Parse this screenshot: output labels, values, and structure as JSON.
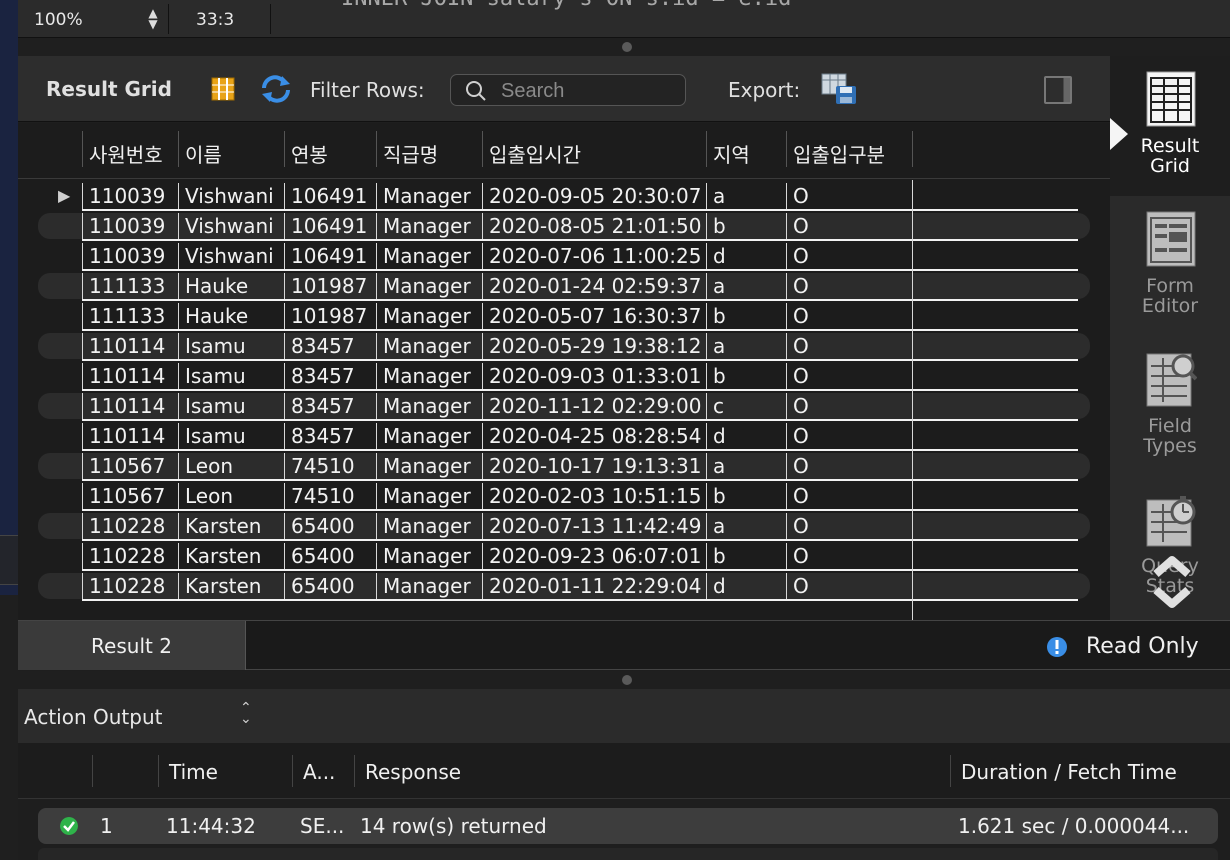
{
  "editor": {
    "code_peek": "    INNER JOIN salary s ON s.id = e.id",
    "zoom": "100%",
    "cursor_position": "33:3"
  },
  "result_toolbar": {
    "title": "Result Grid",
    "filter_label": "Filter Rows:",
    "search_placeholder": "Search",
    "export_label": "Export:"
  },
  "grid": {
    "columns": [
      "사원번호",
      "이름",
      "연봉",
      "직급명",
      "입출입시간",
      "지역",
      "입출입구분"
    ],
    "rows": [
      [
        "110039",
        "Vishwani",
        "106491",
        "Manager",
        "2020-09-05 20:30:07",
        "a",
        "O"
      ],
      [
        "110039",
        "Vishwani",
        "106491",
        "Manager",
        "2020-08-05 21:01:50",
        "b",
        "O"
      ],
      [
        "110039",
        "Vishwani",
        "106491",
        "Manager",
        "2020-07-06 11:00:25",
        "d",
        "O"
      ],
      [
        "111133",
        "Hauke",
        "101987",
        "Manager",
        "2020-01-24 02:59:37",
        "a",
        "O"
      ],
      [
        "111133",
        "Hauke",
        "101987",
        "Manager",
        "2020-05-07 16:30:37",
        "b",
        "O"
      ],
      [
        "110114",
        "Isamu",
        "83457",
        "Manager",
        "2020-05-29 19:38:12",
        "a",
        "O"
      ],
      [
        "110114",
        "Isamu",
        "83457",
        "Manager",
        "2020-09-03 01:33:01",
        "b",
        "O"
      ],
      [
        "110114",
        "Isamu",
        "83457",
        "Manager",
        "2020-11-12 02:29:00",
        "c",
        "O"
      ],
      [
        "110114",
        "Isamu",
        "83457",
        "Manager",
        "2020-04-25 08:28:54",
        "d",
        "O"
      ],
      [
        "110567",
        "Leon",
        "74510",
        "Manager",
        "2020-10-17 19:13:31",
        "a",
        "O"
      ],
      [
        "110567",
        "Leon",
        "74510",
        "Manager",
        "2020-02-03 10:51:15",
        "b",
        "O"
      ],
      [
        "110228",
        "Karsten",
        "65400",
        "Manager",
        "2020-07-13 11:42:49",
        "a",
        "O"
      ],
      [
        "110228",
        "Karsten",
        "65400",
        "Manager",
        "2020-09-23 06:07:01",
        "b",
        "O"
      ],
      [
        "110228",
        "Karsten",
        "65400",
        "Manager",
        "2020-01-11 22:29:04",
        "d",
        "O"
      ]
    ],
    "current_row_marker": "▶"
  },
  "side_panel": {
    "items": [
      {
        "label": "Result\nGrid",
        "icon": "result-grid-icon",
        "active": true
      },
      {
        "label": "Form\nEditor",
        "icon": "form-editor-icon",
        "active": false
      },
      {
        "label": "Field\nTypes",
        "icon": "field-types-icon",
        "active": false
      },
      {
        "label": "Query\nStats",
        "icon": "query-stats-icon",
        "active": false
      }
    ]
  },
  "result_tabs": {
    "tab_label": "Result 2",
    "read_only_label": "Read Only"
  },
  "action_output": {
    "title": "Action Output",
    "columns": [
      "Time",
      "A...",
      "Response",
      "Duration / Fetch Time"
    ],
    "rows": [
      {
        "index": "1",
        "time": "11:44:32",
        "action": "SE...",
        "response": "14 row(s) returned",
        "duration": "1.621 sec / 0.000044..."
      }
    ]
  },
  "colors": {
    "background": "#1e1e1e",
    "toolbar": "#2d2d2d",
    "success": "#2fb34a",
    "info_blue": "#3a8ee6"
  }
}
